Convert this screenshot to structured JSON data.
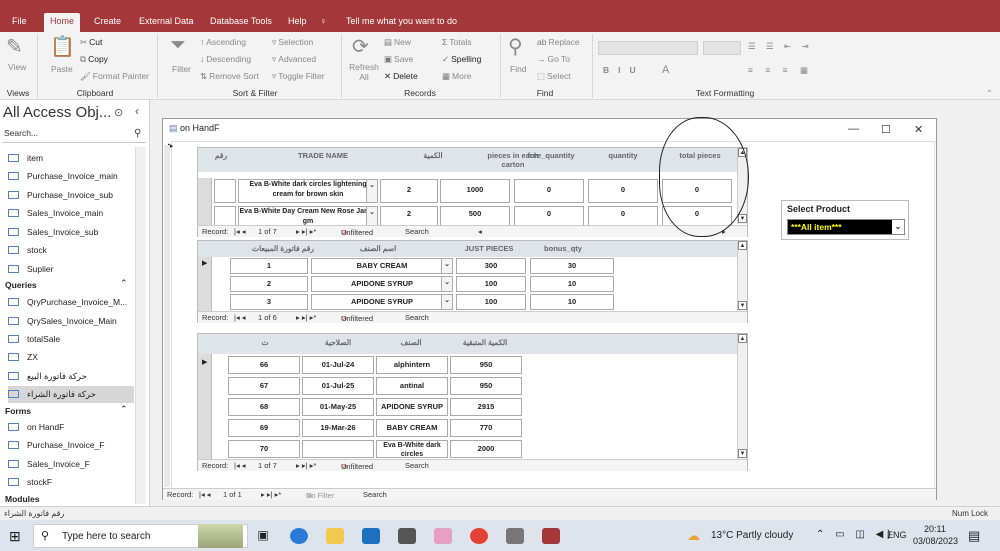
{
  "tabs": [
    "File",
    "Home",
    "Create",
    "External Data",
    "Database Tools",
    "Help"
  ],
  "tell_me": "Tell me what you want to do",
  "ribbon": {
    "views": {
      "view": "View",
      "label": "Views"
    },
    "clipboard": {
      "paste": "Paste",
      "cut": "Cut",
      "copy": "Copy",
      "format_painter": "Format Painter",
      "label": "Clipboard"
    },
    "sort_filter": {
      "filter": "Filter",
      "ascending": "Ascending",
      "descending": "Descending",
      "remove_sort": "Remove Sort",
      "selection": "Selection",
      "advanced": "Advanced",
      "toggle_filter": "Toggle Filter",
      "label": "Sort & Filter"
    },
    "records": {
      "refresh": "Refresh All",
      "new": "New",
      "save": "Save",
      "delete": "Delete",
      "totals": "Totals",
      "spelling": "Spelling",
      "more": "More",
      "label": "Records"
    },
    "find": {
      "find": "Find",
      "replace": "Replace",
      "goto": "Go To",
      "select": "Select",
      "label": "Find"
    },
    "text_formatting": {
      "label": "Text Formatting"
    }
  },
  "nav": {
    "title": "All Access Obj...",
    "search_placeholder": "Search...",
    "tables": [
      "item",
      "Purchase_Invoice_main",
      "Purchase_Invoice_sub",
      "Sales_Invoice_main",
      "Sales_Invoice_sub",
      "stock",
      "Suplier"
    ],
    "queries_header": "Queries",
    "queries": [
      "QryPurchase_Invoice_M...",
      "QrySales_Invoice_Main",
      "totalSale",
      "ZX",
      "حركة فاتورة البيع",
      "حركة فاتورة الشراء"
    ],
    "forms_header": "Forms",
    "forms": [
      "on HandF",
      "Purchase_Invoice_F",
      "Sales_Invoice_F",
      "stockF"
    ],
    "modules_header": "Modules"
  },
  "form": {
    "title": "on HandF",
    "select_product_label": "Select Product",
    "select_product_value": "***All item***",
    "sub1": {
      "headers": [
        "رقم",
        "TRADE NAME",
        "الكمية",
        "pieces in each carton",
        "free_quantity",
        "quantity",
        "total pieces"
      ],
      "rows": [
        [
          "",
          "Eva B-White dark circles lightening cream for brown skin",
          "2",
          "1000",
          "0",
          "0",
          "0"
        ],
        [
          "",
          "Eva B-White Day Cream New Rose Jar 40 gm",
          "2",
          "500",
          "0",
          "0",
          "0"
        ]
      ],
      "record": "Record:",
      "pos": "1 of 7",
      "filter": "Unfiltered",
      "search": "Search"
    },
    "sub2": {
      "headers": [
        "رقم فاتورة المبيعات",
        "اسم الصنف",
        "JUST PIECES",
        "bonus_qty"
      ],
      "rows": [
        [
          "1",
          "BABY CREAM",
          "300",
          "30"
        ],
        [
          "2",
          "APIDONE SYRUP",
          "100",
          "10"
        ],
        [
          "3",
          "APIDONE SYRUP",
          "100",
          "10"
        ]
      ],
      "record": "Record:",
      "pos": "1 of 6",
      "filter": "Unfiltered",
      "search": "Search"
    },
    "sub3": {
      "headers": [
        "ت",
        "الصلاحية",
        "الصنف",
        "الكمية المتبقية"
      ],
      "rows": [
        [
          "66",
          "01-Jul-24",
          "alphintern",
          "950"
        ],
        [
          "67",
          "01-Jul-25",
          "antinal",
          "950"
        ],
        [
          "68",
          "01-May-25",
          "APIDONE SYRUP",
          "2915"
        ],
        [
          "69",
          "19-Mar-26",
          "BABY CREAM",
          "770"
        ],
        [
          "70",
          "",
          "Eva B-White dark circles",
          "2000"
        ]
      ],
      "record": "Record:",
      "pos": "1 of 7",
      "filter": "Unfiltered",
      "search": "Search"
    },
    "main_record": {
      "record": "Record:",
      "pos": "1 of 1",
      "filter": "No Filter",
      "search": "Search"
    }
  },
  "status": {
    "left": "رقم فاتورة الشراء",
    "right": "Num Lock"
  },
  "taskbar": {
    "search": "Type here to search",
    "weather": "13°C  Partly cloudy",
    "lang": "ENG",
    "time": "20:11",
    "date": "03/08/2023"
  }
}
